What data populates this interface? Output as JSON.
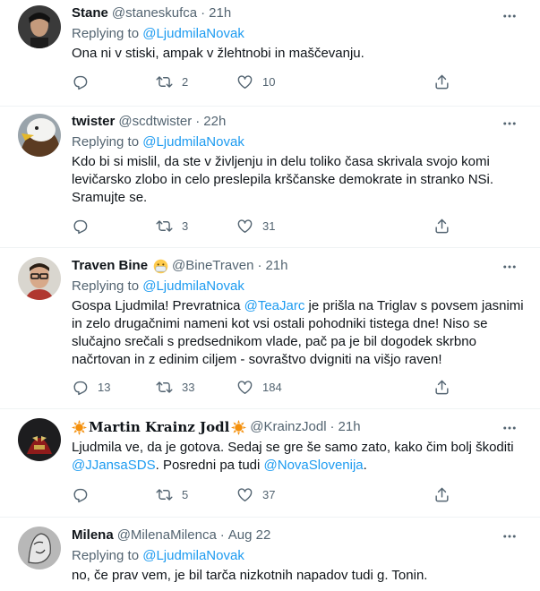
{
  "tweets": [
    {
      "name": "Stane",
      "handle": "@staneskufca",
      "sep": "·",
      "time": "21h",
      "reply_prefix": "Replying to ",
      "reply_to": "@LjudmilaNovak",
      "text_lines": [
        "Ona ni v stiski, ampak v žlehtnobi in maščevanju."
      ],
      "stats": {
        "replies": "",
        "retweets": "2",
        "likes": "10"
      }
    },
    {
      "name": "twister",
      "handle": "@scdtwister",
      "sep": "·",
      "time": "22h",
      "reply_prefix": "Replying to ",
      "reply_to": "@LjudmilaNovak",
      "text_lines": [
        "Kdo bi si mislil, da ste v življenju in delu toliko časa skrivala svojo komi",
        "levičarsko zlobo in celo preslepila krščanske demokrate in stranko NSi.",
        "Sramujte se."
      ],
      "stats": {
        "replies": "",
        "retweets": "3",
        "likes": "31"
      }
    },
    {
      "name": "Traven Bine",
      "handle": "@BineTraven",
      "sep": "·",
      "time": "21h",
      "reply_prefix": "Replying to ",
      "reply_to": "@LjudmilaNovak",
      "text_a": "Gospa Ljudmila! Prevratnica ",
      "mention": "@TeaJarc",
      "text_b": " je prišla na Triglav s povsem jasnimi",
      "text_lines_rest": [
        "in zelo drugačnimi nameni kot vsi ostali pohodniki tistega dne! Niso se",
        "slučajno srečali s predsednikom vlade, pač pa je bil dogodek skrbno",
        "načrtovan in z edinim ciljem - sovraštvo dvigniti na višjo raven!"
      ],
      "stats": {
        "replies": "13",
        "retweets": "33",
        "likes": "184"
      }
    },
    {
      "name": "Martin Krainz Jodl",
      "handle": "@KrainzJodl",
      "sep": "·",
      "time": "21h",
      "text_line1": "Ljudmila ve, da je gotova. Sedaj se gre še samo zato, kako čim bolj škoditi",
      "mention1": "@JJansaSDS",
      "text_mid": ". Posredni pa tudi ",
      "mention2": "@NovaSlovenija",
      "text_end": ".",
      "stats": {
        "replies": "",
        "retweets": "5",
        "likes": "37"
      }
    },
    {
      "name": "Milena",
      "handle": "@MilenaMilenca",
      "sep": "·",
      "time": "Aug 22",
      "reply_prefix": "Replying to ",
      "reply_to": "@LjudmilaNovak",
      "text_lines": [
        "no, če prav vem, je bil tarča nizkotnih napadov tudi g. Tonin."
      ]
    }
  ],
  "colors": {
    "link": "#1d9bf0",
    "secondary": "#536471",
    "divider": "#eff3f4"
  },
  "icons": [
    "reply-icon",
    "retweet-icon",
    "like-icon",
    "share-icon",
    "more-icon",
    "mask-emoji-icon",
    "sun-emoji-icon"
  ]
}
